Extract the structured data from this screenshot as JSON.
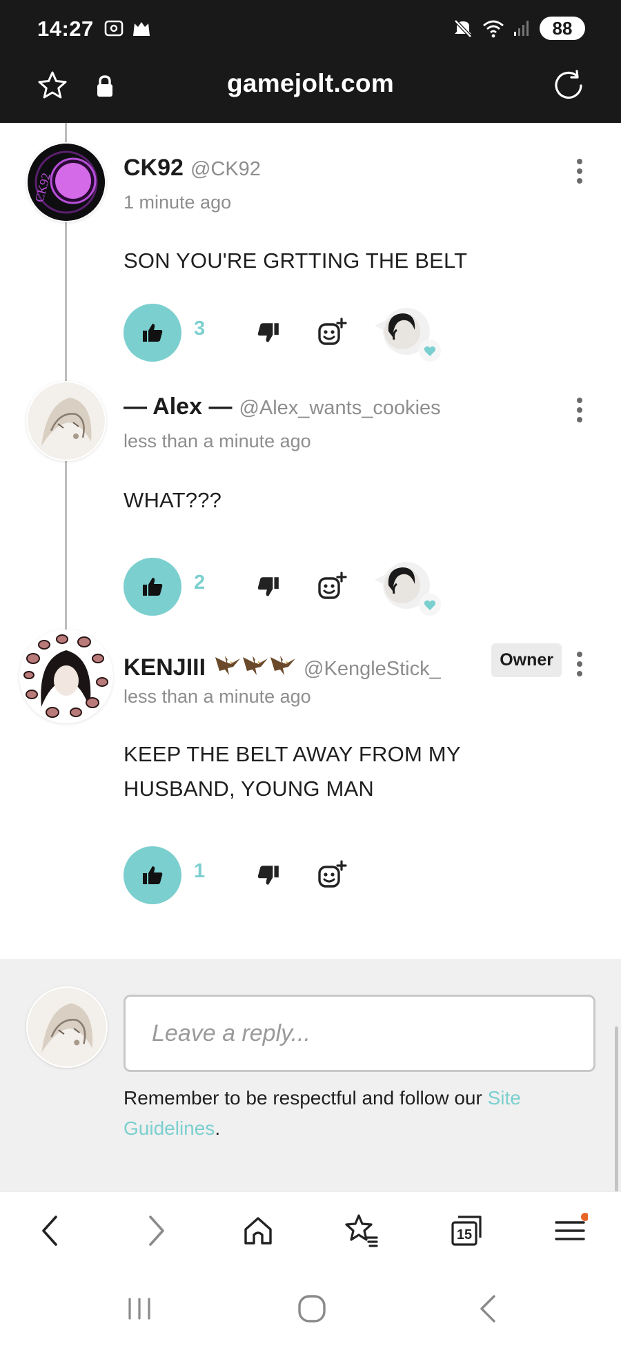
{
  "status_bar": {
    "time": "14:27",
    "battery": "88",
    "icons": [
      "screenshot-icon",
      "cat-icon",
      "mute-icon",
      "wifi-icon",
      "signal-icon",
      "battery-icon"
    ]
  },
  "browser": {
    "url": "gamejolt.com",
    "icons": [
      "star-icon",
      "lock-icon",
      "reload-icon"
    ]
  },
  "colors": {
    "accent": "#7ccfcf",
    "topbar": "#191919",
    "muted_text": "#8e8e8e",
    "composer_bg": "#f0f0f0"
  },
  "comments": [
    {
      "name": "CK92",
      "handle": "@CK92",
      "time": "1 minute ago",
      "text": "SON YOU'RE GRTTING THE BELT",
      "likes": "3",
      "has_reaction": true,
      "avatar_text": "CK92"
    },
    {
      "name": "— Alex —",
      "handle": "@Alex_wants_cookies",
      "time": "less than a minute ago",
      "text": "WHAT???",
      "likes": "2",
      "has_reaction": true
    },
    {
      "name": "KENJIII",
      "handle": "@KengleStick_",
      "time": "less than a minute ago",
      "text": "KEEP THE BELT AWAY FROM MY HUSBAND, YOUNG MAN",
      "likes": "1",
      "badge": "Owner",
      "has_reaction": false
    }
  ],
  "composer": {
    "placeholder": "Leave a reply...",
    "note_prefix": "Remember to be respectful and follow our ",
    "note_link": "Site Guidelines",
    "note_suffix": "."
  },
  "bottom_nav": {
    "tabs_count": "15",
    "icons": [
      "back-icon",
      "forward-icon",
      "home-icon",
      "bookmarks-icon",
      "tabs-icon",
      "menu-icon"
    ]
  },
  "system_nav": {
    "icons": [
      "recents-icon",
      "home-circle-icon",
      "system-back-icon"
    ]
  }
}
